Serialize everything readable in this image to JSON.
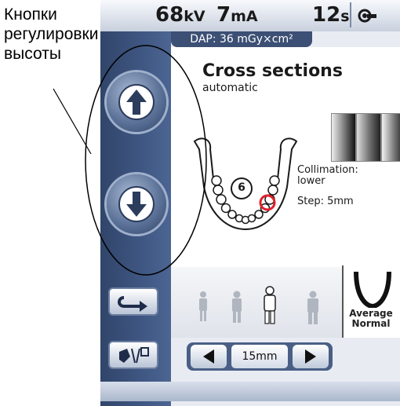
{
  "annotation": {
    "lines": [
      "Кнопки",
      "регулировки",
      "высоты"
    ]
  },
  "status": {
    "kv_value": "68",
    "kv_unit": "kV",
    "ma_value": "7",
    "ma_unit": "mA",
    "time_value": "12",
    "time_unit": "s",
    "dap": "DAP: 36 mGy×cm²"
  },
  "program": {
    "title": "Cross sections",
    "subtitle": "automatic"
  },
  "settings": {
    "collimation_label": "Collimation:",
    "collimation_value": "lower",
    "step": "Step: 5mm"
  },
  "jaw": {
    "tooth_number": "6"
  },
  "arch": {
    "line1": "Average",
    "line2": "Normal"
  },
  "stepper": {
    "value": "15mm"
  },
  "icons": {
    "height_up": "arrow-up-icon",
    "height_down": "arrow-down-icon",
    "settings": "wrench-icon",
    "return": "return-arrow-icon",
    "patient_position": "patient-position-icon"
  },
  "colors": {
    "panel_blue": "#3f5783",
    "highlight_red": "#e0202a"
  }
}
